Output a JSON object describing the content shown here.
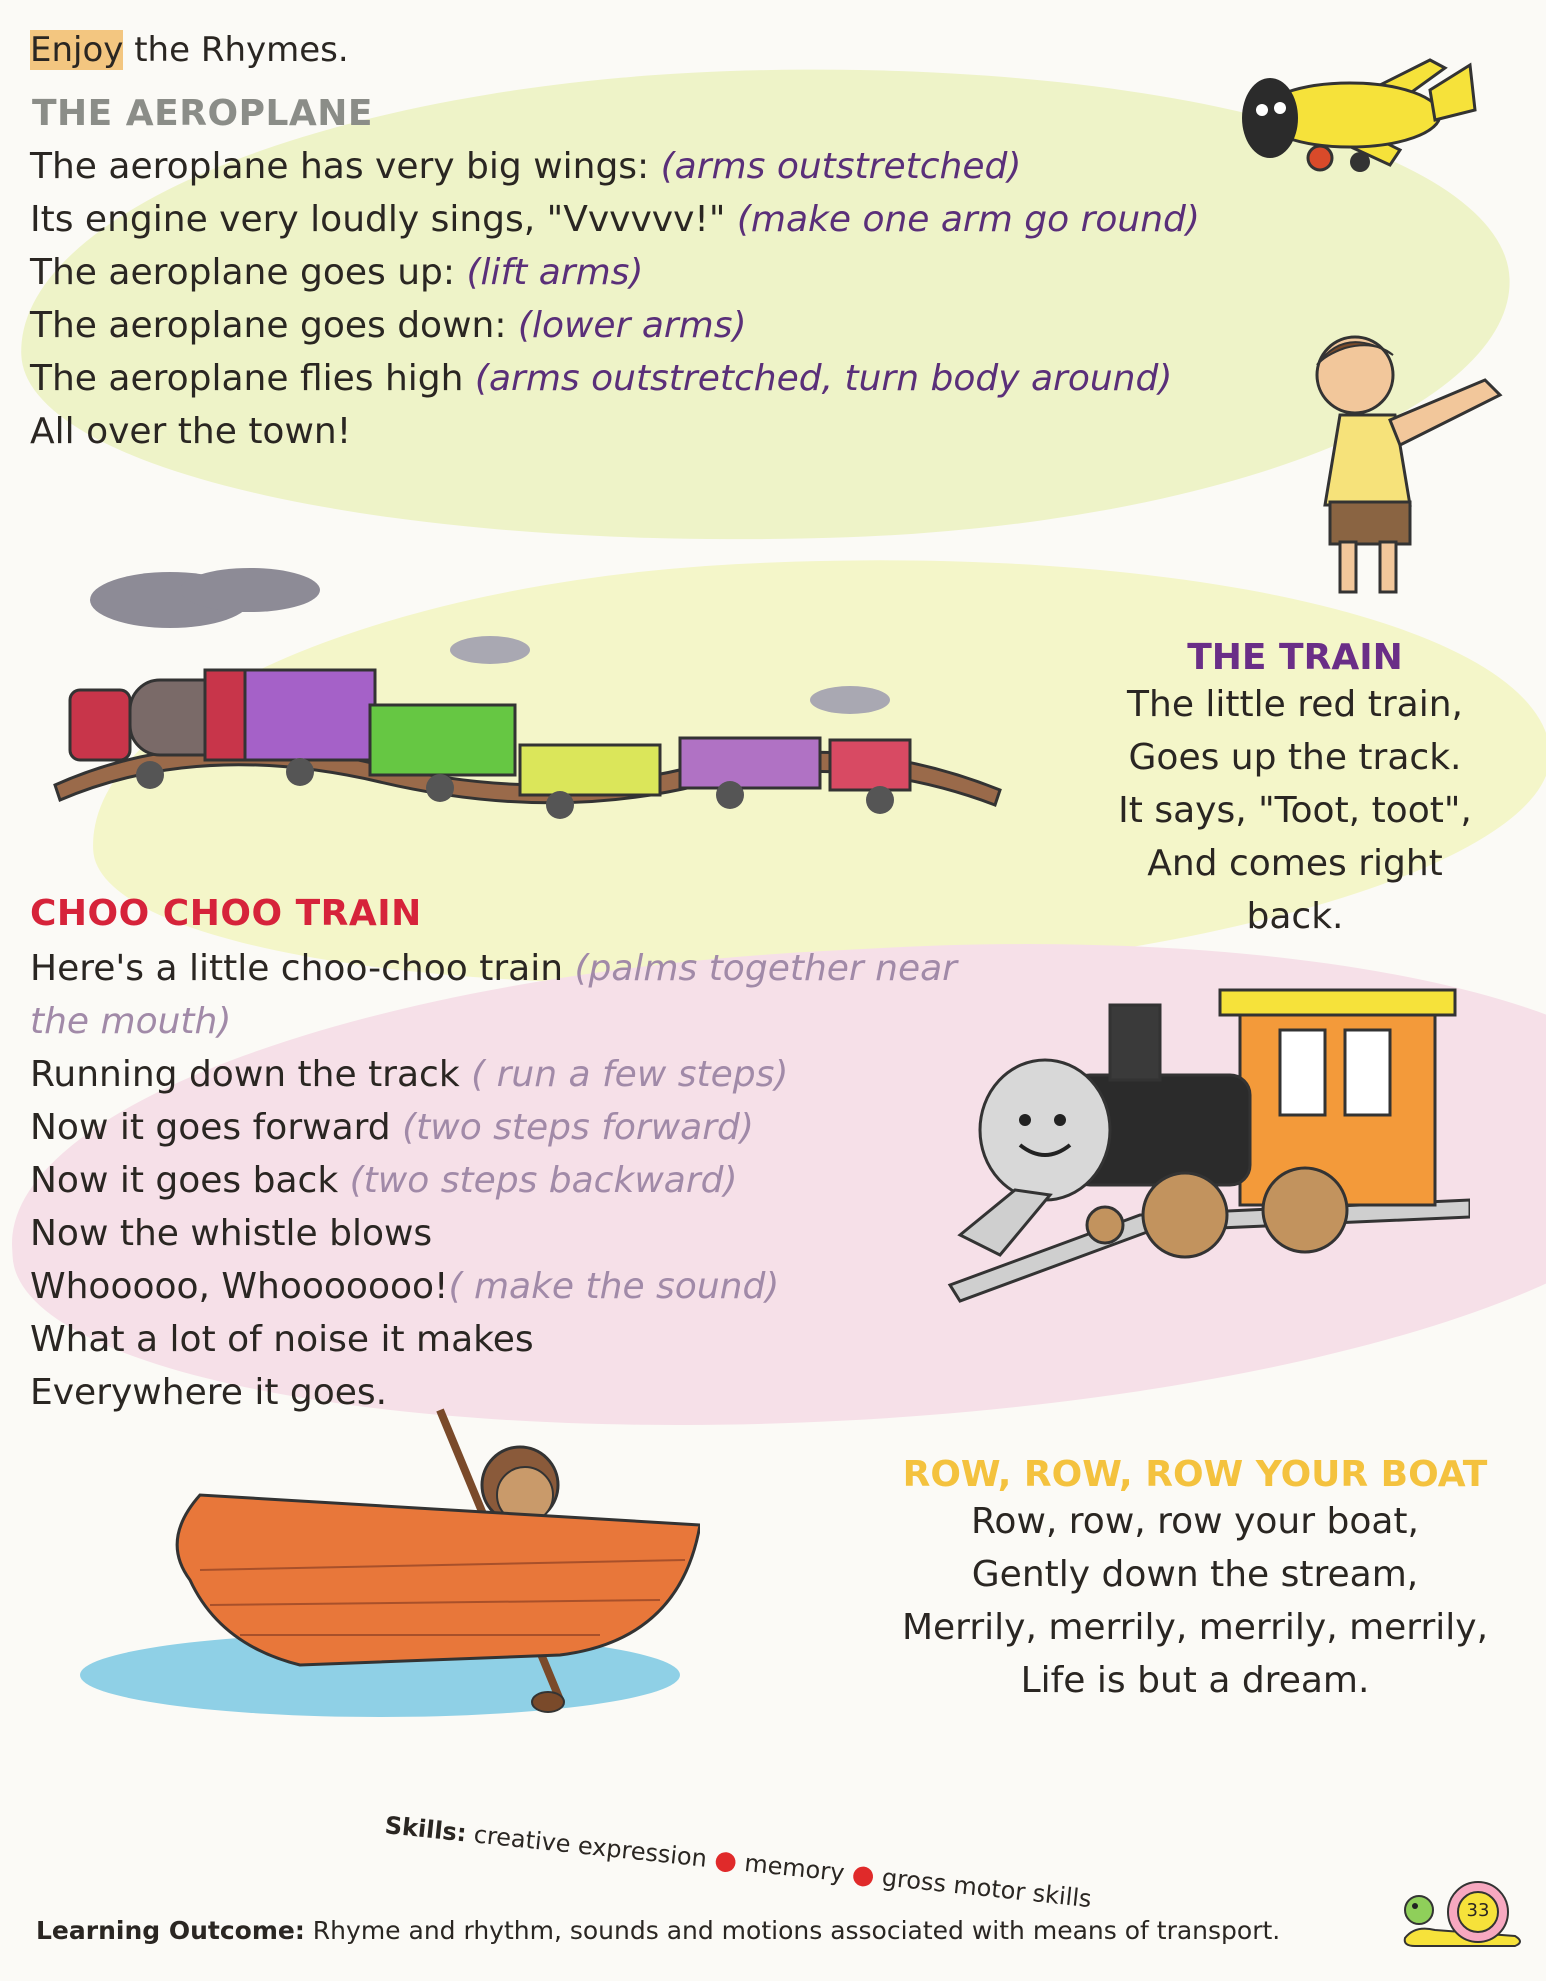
{
  "intro": {
    "highlight": "Enjoy",
    "rest": " the Rhymes."
  },
  "aeroplane": {
    "title": "THE AEROPLANE",
    "lines": [
      {
        "text": "The aeroplane has very big wings: ",
        "action": "(arms outstretched)"
      },
      {
        "text": "Its engine very loudly sings, \"Vvvvvv!\" ",
        "action": "(make one arm go round)"
      },
      {
        "text": "The aeroplane goes up: ",
        "action": "(lift arms)"
      },
      {
        "text": "The aeroplane goes down: ",
        "action": "(lower arms)"
      },
      {
        "text": "The aeroplane flies high ",
        "action": "(arms outstretched, turn body around)"
      },
      {
        "text": "All over the  town!",
        "action": ""
      }
    ]
  },
  "train": {
    "title": "THE TRAIN",
    "lines": [
      "The little red train,",
      "Goes up the track.",
      "It says, \"Toot, toot\",",
      "And comes right",
      "back."
    ]
  },
  "choo_choo": {
    "title": "CHOO CHOO TRAIN",
    "lines": [
      {
        "text": "Here's a little choo-choo train ",
        "action": "(palms together near"
      },
      {
        "text": "",
        "action": "the mouth)"
      },
      {
        "text": "Running down the track ",
        "action": "( run a few steps)"
      },
      {
        "text": "Now it goes forward ",
        "action": "(two steps forward)"
      },
      {
        "text": "Now it goes back ",
        "action": "(two steps backward)"
      },
      {
        "text": "Now the whistle blows",
        "action": ""
      },
      {
        "text": "Whooooo, Whooooooo!",
        "action": "( make the sound)"
      },
      {
        "text": "What a lot of noise it makes",
        "action": ""
      },
      {
        "text": "Everywhere it goes.",
        "action": ""
      }
    ]
  },
  "boat": {
    "title": "ROW, ROW, ROW YOUR BOAT",
    "lines": [
      "Row, row, row your boat,",
      "Gently down the stream,",
      "Merrily, merrily, merrily, merrily,",
      "Life is but a dream."
    ]
  },
  "skills": {
    "label": "Skills:",
    "items": [
      "creative expression",
      "memory",
      "gross motor skills"
    ]
  },
  "learning_outcome": {
    "label": "Learning Outcome:",
    "text": " Rhyme and rhythm, sounds and motions associated with means of transport."
  },
  "page_number": "33",
  "colors": {
    "aero_action": "#5a2f79",
    "train_title": "#6a2e87",
    "choo_title": "#d6233a",
    "choo_action": "#a18aa8",
    "boat_title": "#f4c23e",
    "skill_dot": "#e02a2a"
  },
  "icons": [
    "aeroplane-illustration",
    "boy-illustration",
    "train-illustration",
    "steam-engine-illustration",
    "girl-rowing-boat-illustration",
    "snail-icon"
  ]
}
